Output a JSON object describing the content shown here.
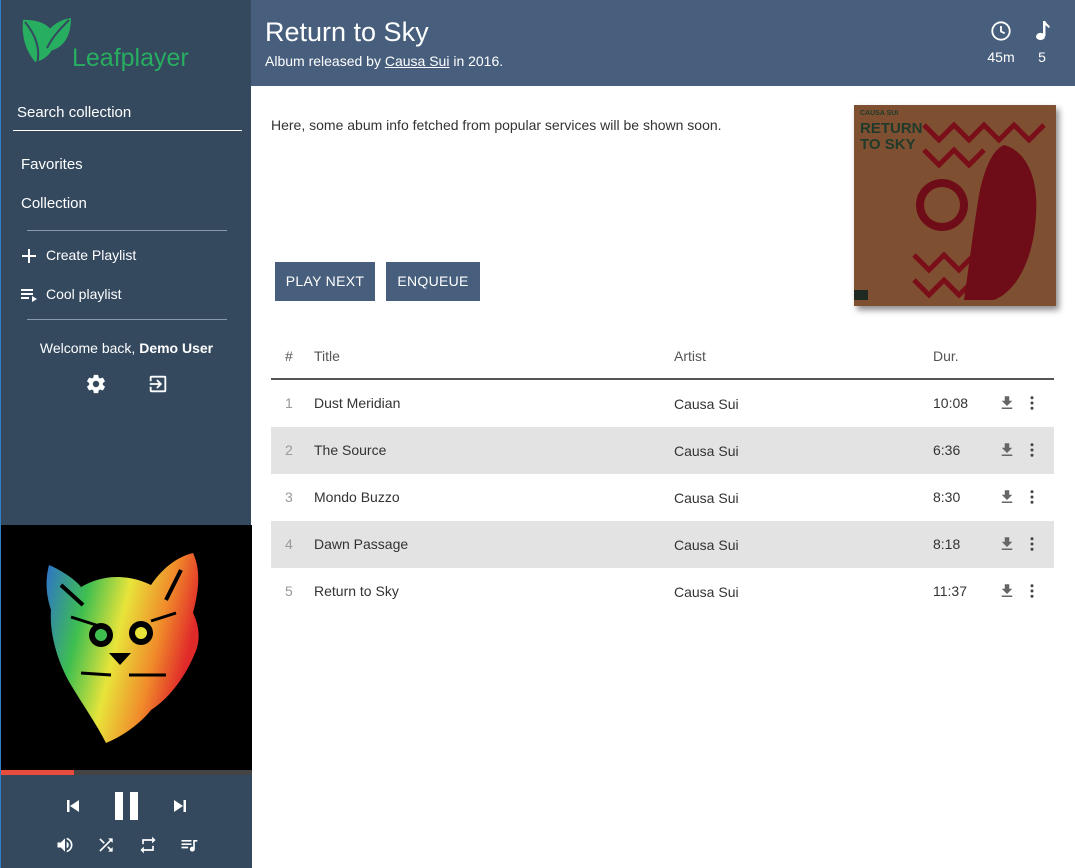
{
  "sidebar": {
    "logo_text": "Leafplayer",
    "search_placeholder": "Search collection",
    "nav": [
      {
        "label": "Favorites"
      },
      {
        "label": "Collection"
      }
    ],
    "playlists": [
      {
        "label": "Create Playlist",
        "icon": "plus-icon"
      },
      {
        "label": "Cool playlist",
        "icon": "playlist-icon"
      }
    ],
    "welcome_prefix": "Welcome back, ",
    "welcome_user": "Demo User"
  },
  "player": {
    "progress_fraction": 0.29
  },
  "header": {
    "title": "Return to Sky",
    "subtitle_prefix": "Album released by ",
    "artist_link": "Causa Sui",
    "subtitle_suffix": " in 2016.",
    "duration": "45m",
    "track_count": "5"
  },
  "content": {
    "info_text": "Here, some abum info fetched from popular services will be shown soon.",
    "play_next_label": "PLAY NEXT",
    "enqueue_label": "ENQUEUE"
  },
  "table": {
    "headers": {
      "num": "#",
      "title": "Title",
      "artist": "Artist",
      "duration": "Dur."
    },
    "rows": [
      {
        "num": "1",
        "title": "Dust Meridian",
        "artist": "Causa Sui",
        "duration": "10:08"
      },
      {
        "num": "2",
        "title": "The Source",
        "artist": "Causa Sui",
        "duration": "6:36"
      },
      {
        "num": "3",
        "title": "Mondo Buzzo",
        "artist": "Causa Sui",
        "duration": "8:30"
      },
      {
        "num": "4",
        "title": "Dawn Passage",
        "artist": "Causa Sui",
        "duration": "8:18"
      },
      {
        "num": "5",
        "title": "Return to Sky",
        "artist": "Causa Sui",
        "duration": "11:37"
      }
    ]
  },
  "colors": {
    "sidebar": "#34495e",
    "header": "#475f7d",
    "brand": "#27ae60",
    "progress": "#e74c3c"
  }
}
